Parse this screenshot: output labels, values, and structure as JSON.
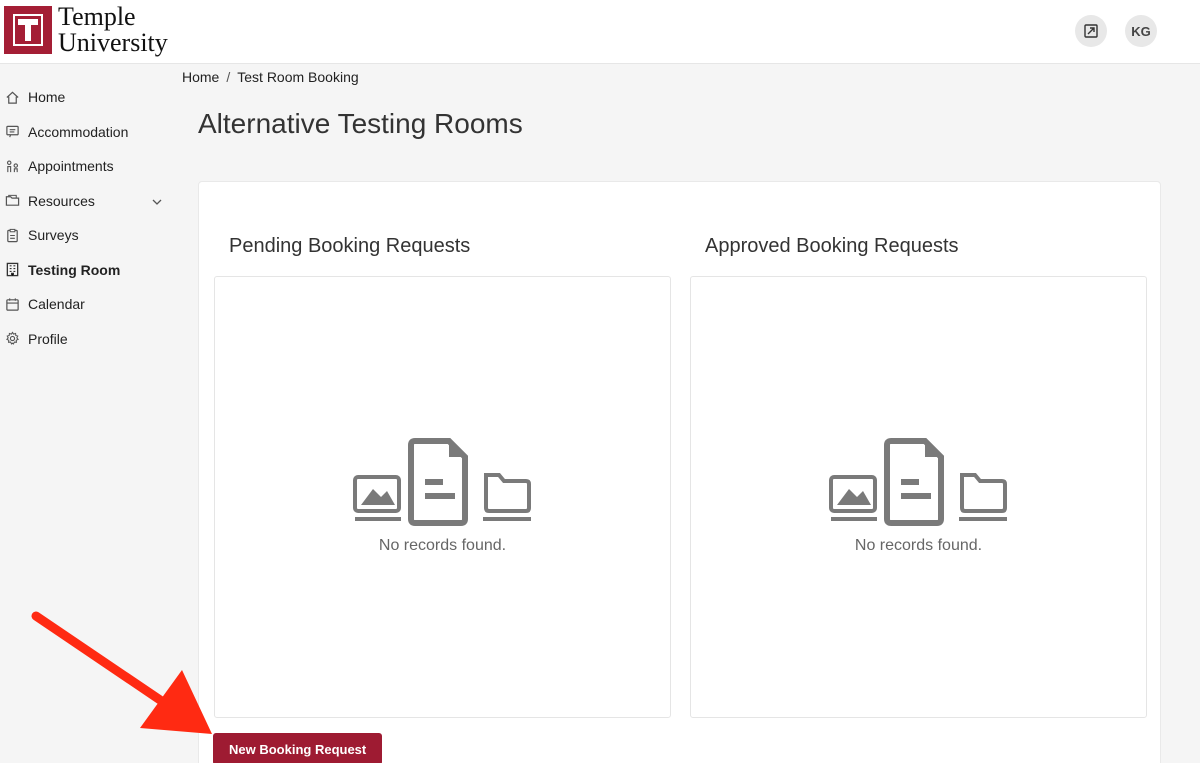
{
  "brand": {
    "line1": "Temple",
    "line2": "University",
    "color": "#a41e35"
  },
  "header": {
    "expand_icon": "expand-icon",
    "avatar_initials": "KG"
  },
  "sidebar": {
    "items": [
      {
        "label": "Home",
        "icon": "home-icon"
      },
      {
        "label": "Accommodation",
        "icon": "message-icon"
      },
      {
        "label": "Appointments",
        "icon": "people-icon"
      },
      {
        "label": "Resources",
        "icon": "folder-icon"
      },
      {
        "label": "Surveys",
        "icon": "clipboard-icon"
      },
      {
        "label": "Testing Room",
        "icon": "building-icon",
        "active": true
      },
      {
        "label": "Calendar",
        "icon": "calendar-icon"
      },
      {
        "label": "Profile",
        "icon": "gear-icon"
      }
    ]
  },
  "breadcrumb": {
    "home": "Home",
    "separator": "/",
    "current": "Test Room Booking"
  },
  "page": {
    "title": "Alternative Testing Rooms"
  },
  "pending": {
    "title": "Pending Booking Requests",
    "empty_message": "No records found."
  },
  "approved": {
    "title": "Approved Booking Requests",
    "empty_message": "No records found."
  },
  "actions": {
    "new_booking_label": "New Booking Request",
    "button_color": "#9e1b32"
  },
  "annotation": {
    "arrow_color": "#ff2a12"
  }
}
